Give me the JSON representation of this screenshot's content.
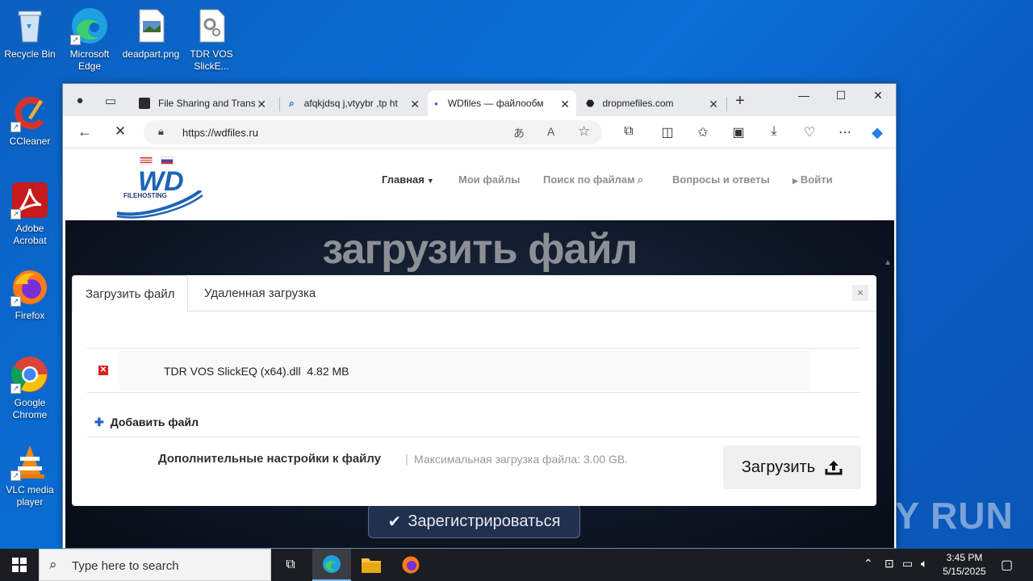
{
  "desktop": {
    "icons": [
      {
        "label": "Recycle Bin"
      },
      {
        "label": "Microsoft Edge"
      },
      {
        "label": "deadpart.png"
      },
      {
        "label": "TDR VOS SlickE..."
      },
      {
        "label": "CCleaner"
      },
      {
        "label": "Adobe Acrobat"
      },
      {
        "label": "Firefox"
      },
      {
        "label": "Google Chrome"
      },
      {
        "label": "VLC media player"
      }
    ]
  },
  "browser": {
    "tabs": [
      {
        "title": "File Sharing and Transf"
      },
      {
        "title": "afqkjdsq j,vtyybr ,tp ht"
      },
      {
        "title": "WDfiles — файлообм"
      },
      {
        "title": "dropmefiles.com"
      }
    ],
    "active_tab_index": 2,
    "url": "https://wdfiles.ru"
  },
  "site": {
    "logo_text": "WD",
    "logo_sub": "FILEHOSTING",
    "nav": {
      "home": "Главная",
      "my_files": "Мои файлы",
      "search": "Поиск по файлам",
      "faq": "Вопросы и ответы",
      "login": "Войти"
    },
    "hero_title": "загрузить файл",
    "register_label": "Зарегистрироваться"
  },
  "dialog": {
    "tab_upload": "Загрузить файл",
    "tab_remote": "Удаленная загрузка",
    "close": "×",
    "file": {
      "name": "TDR VOS SlickEQ (x64).dll",
      "size": "4.82 MB"
    },
    "add_file": "Добавить файл",
    "settings_label": "Дополнительные настройки к файлу",
    "separator": "|",
    "max_upload": "Максимальная загрузка файла: 3.00 GB.",
    "upload_button": "Загрузить"
  },
  "watermark": "ANY RUN",
  "taskbar": {
    "search_placeholder": "Type here to search",
    "time": "3:45 PM",
    "date": "5/15/2025"
  },
  "colors": {
    "desktop": "#0a63c9",
    "hero": "#101a2a",
    "accent": "#2563c7",
    "remove": "#d9221f"
  }
}
